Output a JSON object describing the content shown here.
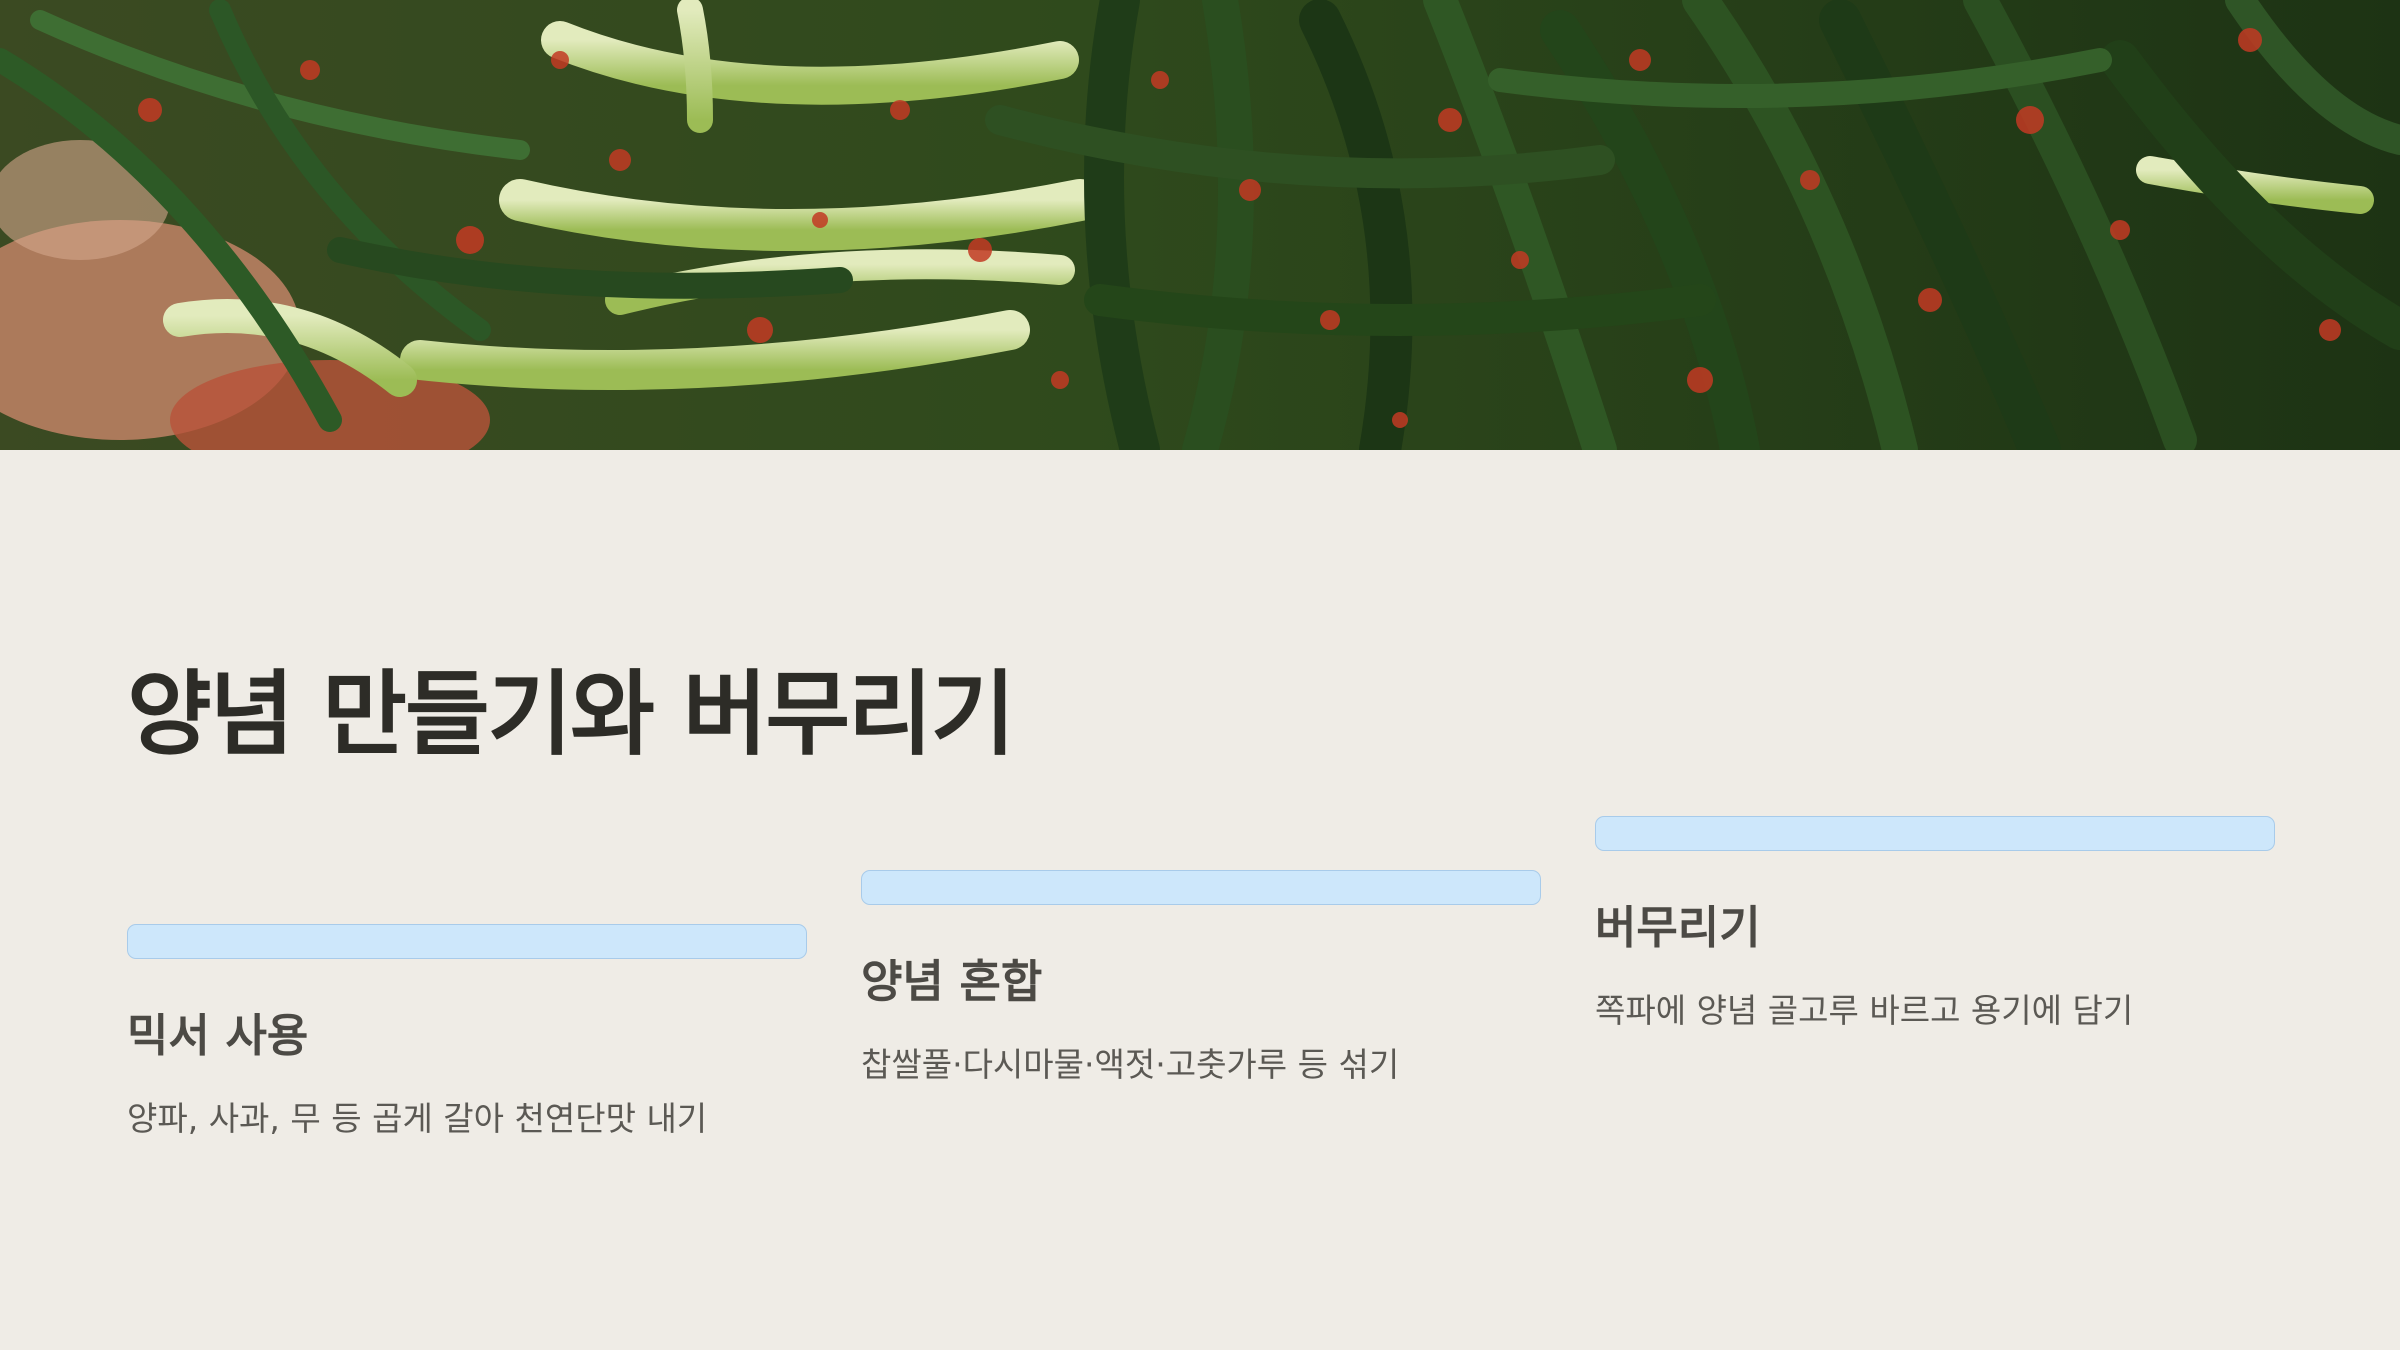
{
  "hero": {
    "image": "green-onion-kimchi-photo",
    "colors": {
      "dark_green": "#1f3a16",
      "green": "#3f6b2a",
      "light_green": "#8fb44a",
      "pale_stem": "#d9e3b4",
      "red_paste": "#c23a23"
    }
  },
  "title": "양념 만들기와 버무리기",
  "cards": [
    {
      "heading": "믹서 사용",
      "description": "양파, 사과, 무 등 곱게 갈아 천연단맛 내기"
    },
    {
      "heading": "양념 혼합",
      "description": "찹쌀풀·다시마물·액젓·고춧가루 등 섞기"
    },
    {
      "heading": "버무리기",
      "description": "쪽파에 양념 골고루 바르고 용기에 담기"
    }
  ],
  "colors": {
    "background": "#efece6",
    "title_text": "#2d2c27",
    "accent_bar": "#cde7fb",
    "accent_bar_border": "#a8cbea"
  }
}
